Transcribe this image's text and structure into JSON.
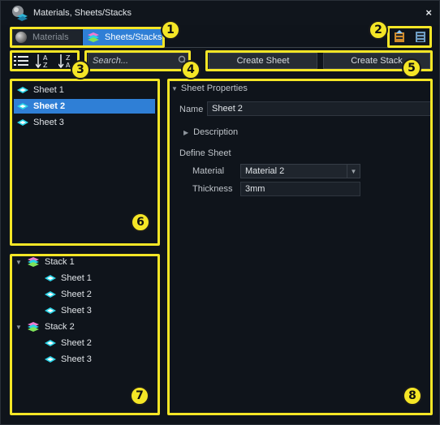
{
  "window": {
    "title": "Materials, Sheets/Stacks",
    "close_glyph": "×"
  },
  "tabs": [
    {
      "label": "Materials",
      "icon": "material-ball-icon",
      "active": false
    },
    {
      "label": "Sheets/Stacks",
      "icon": "stack-icon",
      "active": true
    }
  ],
  "toolbar": {
    "list_view_icon": "list-view-icon",
    "sort_az_icon": "sort-a-z-icon",
    "sort_za_icon": "sort-z-a-icon",
    "export_icon": "export-icon",
    "import_icon": "import-icon"
  },
  "search": {
    "placeholder": "Search...",
    "value": ""
  },
  "actions": {
    "create_sheet": "Create Sheet",
    "create_stack": "Create Stack"
  },
  "sheets": [
    {
      "label": "Sheet 1",
      "selected": false
    },
    {
      "label": "Sheet 2",
      "selected": true
    },
    {
      "label": "Sheet 3",
      "selected": false
    }
  ],
  "stacks": [
    {
      "label": "Stack 1",
      "expanded": true,
      "sheets": [
        "Sheet 1",
        "Sheet 2",
        "Sheet 3"
      ]
    },
    {
      "label": "Stack 2",
      "expanded": true,
      "sheets": [
        "Sheet 2",
        "Sheet 3"
      ]
    }
  ],
  "properties": {
    "section_title": "Sheet Properties",
    "name_label": "Name",
    "name_value": "Sheet 2",
    "description_label": "Description",
    "define_sheet_label": "Define Sheet",
    "material_label": "Material",
    "material_value": "Material 2",
    "thickness_label": "Thickness",
    "thickness_value": "3mm"
  },
  "callouts": [
    "1",
    "2",
    "3",
    "4",
    "5",
    "6",
    "7",
    "8"
  ],
  "colors": {
    "highlight": "#f5e626",
    "selection": "#2f7fd6",
    "sheet_icon": "#29d4e8",
    "background": "#0f141b"
  }
}
